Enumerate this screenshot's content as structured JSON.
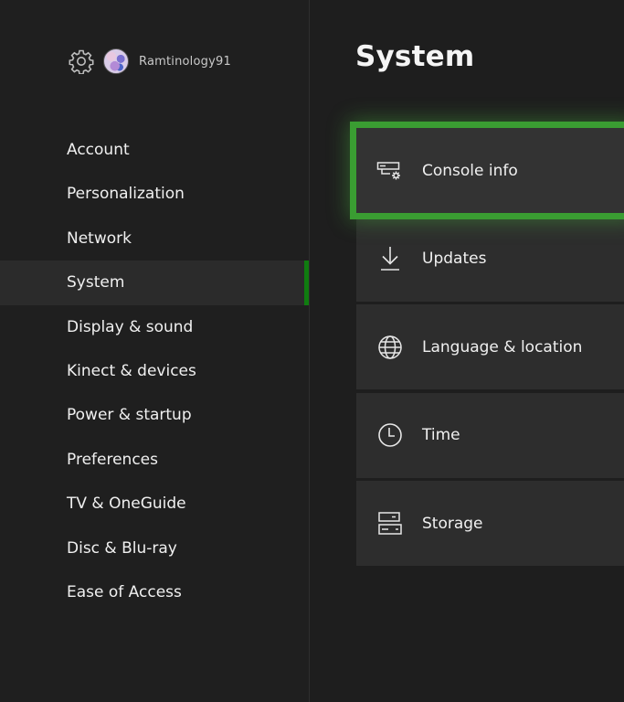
{
  "profile": {
    "username": "Ramtinology91",
    "settings_icon": "gear-icon",
    "avatar_icon": "avatar"
  },
  "sidebar": {
    "items": [
      {
        "label": "Account"
      },
      {
        "label": "Personalization"
      },
      {
        "label": "Network"
      },
      {
        "label": "System",
        "selected": true
      },
      {
        "label": "Display & sound"
      },
      {
        "label": "Kinect & devices"
      },
      {
        "label": "Power & startup"
      },
      {
        "label": "Preferences"
      },
      {
        "label": "TV & OneGuide"
      },
      {
        "label": "Disc & Blu-ray"
      },
      {
        "label": "Ease of Access"
      }
    ]
  },
  "main": {
    "title": "System",
    "tiles": [
      {
        "label": "Console info",
        "icon": "console-settings-icon",
        "focused": true
      },
      {
        "label": "Updates",
        "icon": "download-arrow-icon"
      },
      {
        "label": "Language & location",
        "icon": "globe-icon"
      },
      {
        "label": "Time",
        "icon": "clock-icon"
      },
      {
        "label": "Storage",
        "icon": "storage-drives-icon"
      }
    ]
  },
  "colors": {
    "accent": "#107c10",
    "focus_border": "#3a9d32",
    "background": "#1e1e1e",
    "tile": "#2d2d2d"
  }
}
